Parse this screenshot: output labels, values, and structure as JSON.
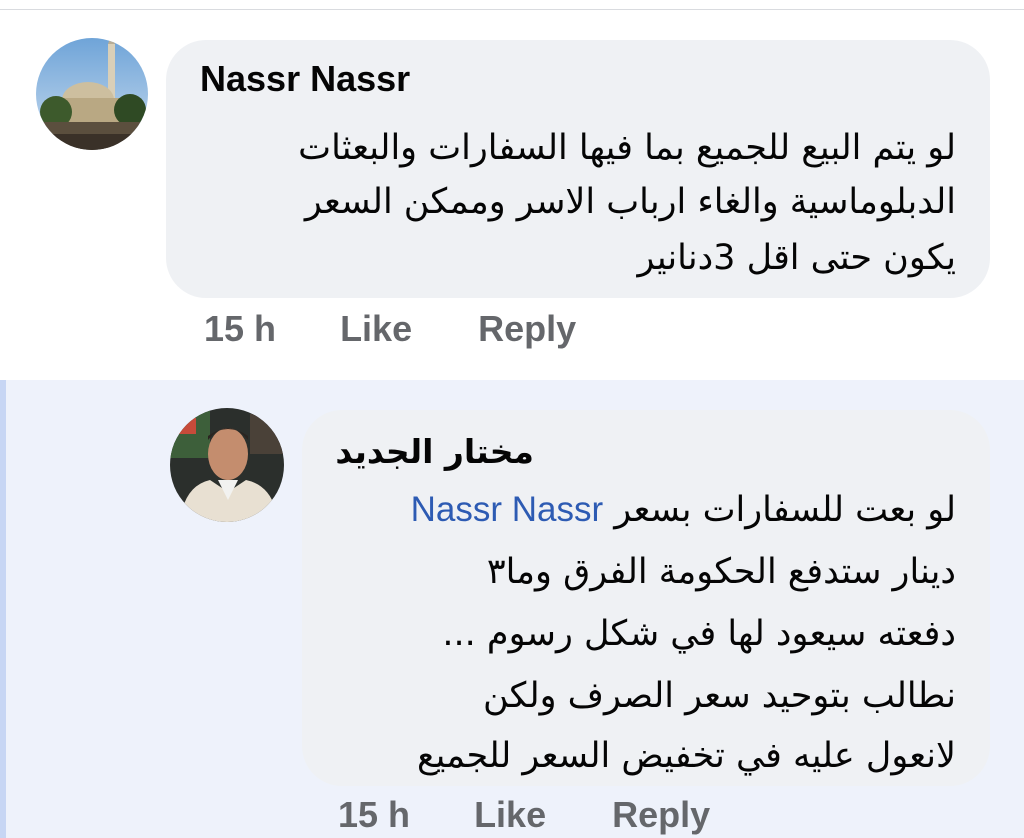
{
  "comment1": {
    "author": "Nassr Nassr",
    "lines": [
      "لو يتم البيع للجميع بما فيها السفارات والبعثات",
      "الدبلوماسية والغاء ارباب الاسر وممكن السعر",
      "يكون حتى اقل 3دنانير"
    ],
    "time": "15 h",
    "like_label": "Like",
    "reply_label": "Reply"
  },
  "comment2": {
    "author": "مختار الجديد",
    "mention": "Nassr Nassr",
    "line1_rest": "لو بعت للسفارات بسعر",
    "lines": [
      "دينار ستدفع الحكومة الفرق وما٣",
      "دفعته سيعود لها في شكل رسوم ...",
      "نطالب بتوحيد سعر الصرف ولكن",
      "لانعول عليه في تخفيض السعر للجميع"
    ],
    "time": "15 h",
    "like_label": "Like",
    "reply_label": "Reply"
  },
  "colors": {
    "bubble": "#eff1f4",
    "meta_text": "#65676b",
    "mention": "#2d5bb3",
    "reply_background": "#eef2fb"
  },
  "icons": [
    "avatar-mosque-photo",
    "avatar-man-photo"
  ]
}
